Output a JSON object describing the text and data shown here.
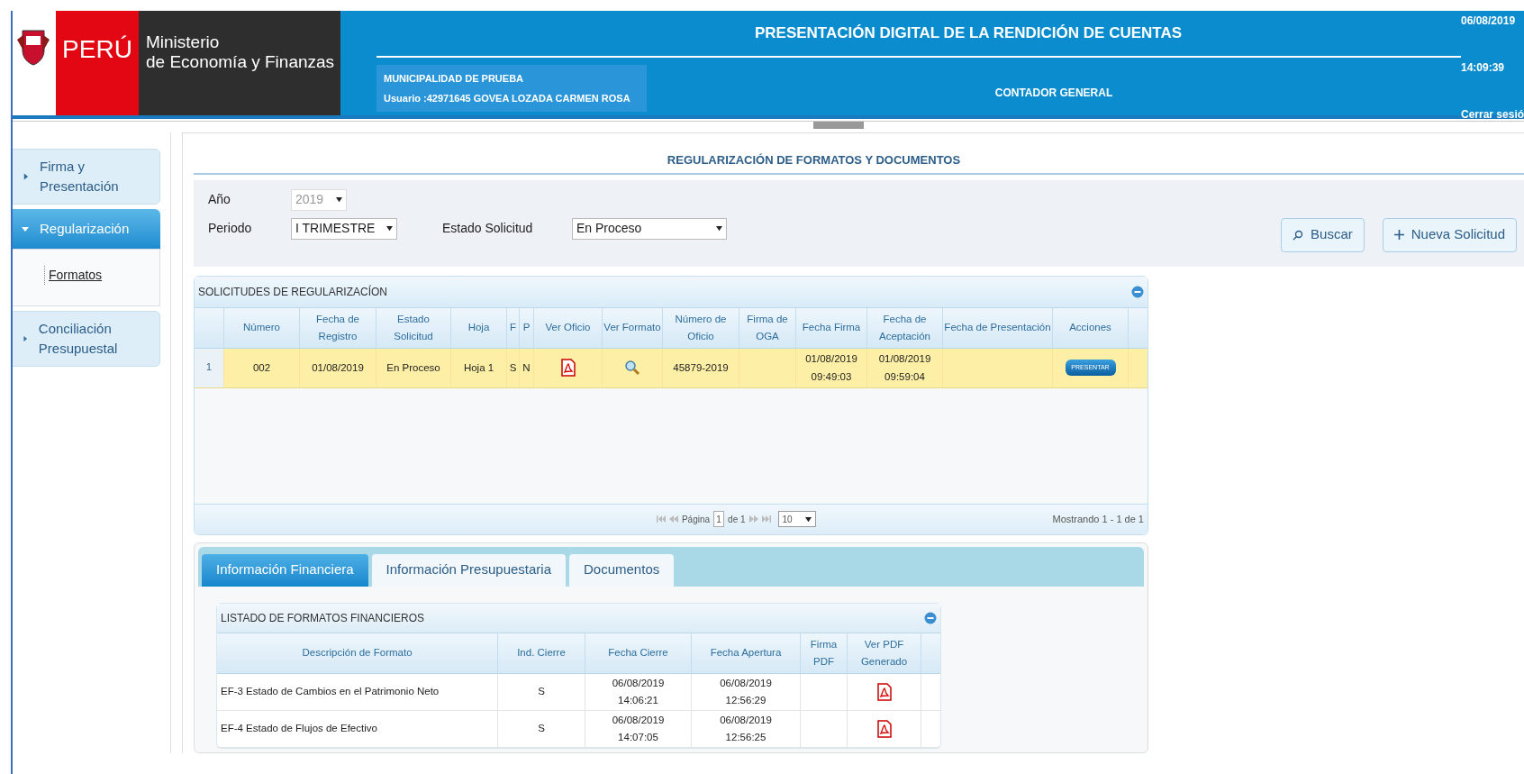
{
  "header": {
    "country": "PERÚ",
    "ministry": [
      "Ministerio",
      "de Economía y Finanzas"
    ],
    "title": "PRESENTACIÓN DIGITAL DE LA RENDICIÓN DE CUENTAS",
    "entity": "MUNICIPALIDAD  DE PRUEBA",
    "user": "Usuario :42971645 GOVEA LOZADA CARMEN  ROSA",
    "role": "CONTADOR GENERAL",
    "date": "06/08/2019",
    "time": "14:09:39",
    "logout": "Cerrar sesió"
  },
  "sidebar": {
    "items": [
      {
        "label": "Firma y Presentación",
        "expanded": false
      },
      {
        "label": "Regularización",
        "expanded": true,
        "children": [
          {
            "label": "Formatos"
          }
        ]
      },
      {
        "label": "Conciliación Presupuestal",
        "expanded": false
      }
    ]
  },
  "page_title": "REGULARIZACIÓN DE FORMATOS Y DOCUMENTOS",
  "filters": [
    {
      "label": "Año",
      "value": "2019",
      "disabled": true
    },
    {
      "label": "Periodo",
      "value": "I TRIMESTRE",
      "disabled": false
    },
    {
      "label": "Estado Solicitud",
      "value": "En Proceso",
      "disabled": false
    }
  ],
  "actions": [
    {
      "label": "Buscar",
      "kind": "search"
    },
    {
      "label": "Nueva Solicitud",
      "kind": "add"
    }
  ],
  "requests": {
    "title": "SOLICITUDES DE REGULARIZACÍON",
    "columns": [
      "",
      "Número",
      "Fecha de Registro",
      "Estado Solicitud",
      "Hoja",
      "F",
      "P",
      "Ver Oficio",
      "Ver Formato",
      "Número de Oficio",
      "Firma de OGA",
      "Fecha Firma",
      "Fecha de Aceptación",
      "Fecha de Presentación",
      "Acciones"
    ],
    "rows": [
      {
        "selected": true,
        "cells": [
          {
            "kind": "index",
            "text": "1"
          },
          {
            "kind": "text",
            "text": "002"
          },
          {
            "kind": "text",
            "text": "01/08/2019"
          },
          {
            "kind": "text",
            "text": "En Proceso"
          },
          {
            "kind": "text",
            "text": "Hoja 1"
          },
          {
            "kind": "text",
            "text": "S"
          },
          {
            "kind": "text",
            "text": "N"
          },
          {
            "kind": "pdf"
          },
          {
            "kind": "view"
          },
          {
            "kind": "text",
            "text": "45879-2019"
          },
          {
            "kind": "empty"
          },
          {
            "kind": "text",
            "text": "01/08/2019 09:49:03"
          },
          {
            "kind": "text",
            "text": "01/08/2019 09:59:04"
          },
          {
            "kind": "empty"
          },
          {
            "kind": "button",
            "text": "PRESENTAR"
          }
        ]
      }
    ],
    "pager": {
      "page_label": "Página",
      "page": "1",
      "of_label": "de 1",
      "page_size": "10",
      "showing": "Mostrando 1 - 1 de 1"
    }
  },
  "tabs": [
    {
      "label": "Información Financiera",
      "selected": true
    },
    {
      "label": "Información Presupuestaria",
      "selected": false
    },
    {
      "label": "Documentos",
      "selected": false
    }
  ],
  "formats": {
    "title": "LISTADO DE FORMATOS FINANCIEROS",
    "columns": [
      "Descripción de Formato",
      "Ind. Cierre",
      "Fecha Cierre",
      "Fecha Apertura",
      "Firma PDF",
      "Ver PDF Generado"
    ],
    "rows": [
      {
        "description": "EF-3 Estado de Cambios en el Patrimonio Neto",
        "closing": "S",
        "closed_at": "06/08/2019 14:06:21",
        "opened_at": "06/08/2019 12:56:29",
        "pdf": true
      },
      {
        "description": "EF-4 Estado de Flujos de Efectivo",
        "closing": "S",
        "closed_at": "06/08/2019 14:07:05",
        "opened_at": "06/08/2019 12:56:25",
        "pdf": true
      }
    ]
  }
}
